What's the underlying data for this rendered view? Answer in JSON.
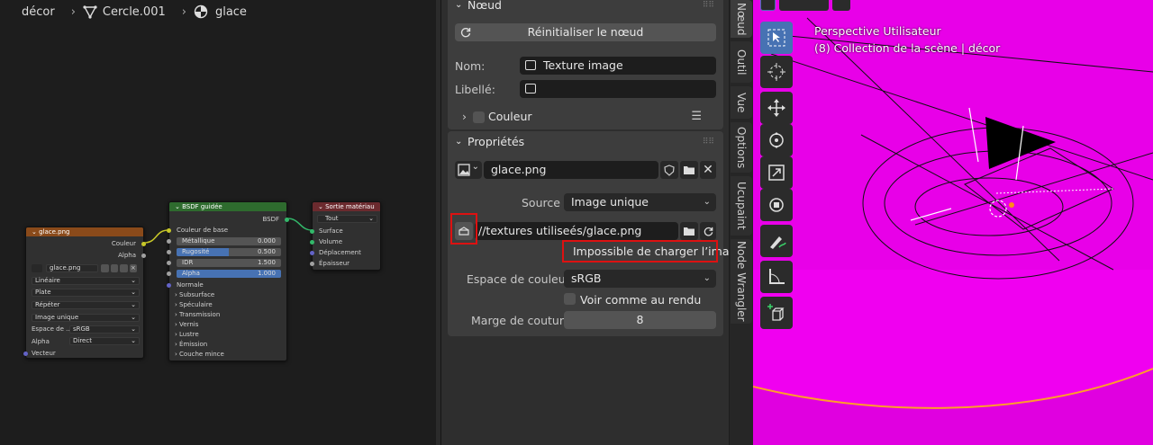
{
  "breadcrumb": {
    "items": [
      "décor",
      "Cercle.001",
      "glace"
    ]
  },
  "node_editor": {
    "image_node": {
      "title": "glace.png",
      "outputs": [
        "Couleur",
        "Alpha"
      ],
      "image_name": "glace.png",
      "interpolation": "Linéaire",
      "projection": "Plate",
      "extension": "Répéter",
      "source": "Image unique",
      "colorspace_label": "Espace de ...",
      "colorspace_value": "sRGB",
      "alpha_label": "Alpha",
      "alpha_value": "Direct",
      "input": "Vecteur"
    },
    "bsdf_node": {
      "title": "BSDF guidée",
      "output": "BSDF",
      "base_color": "Couleur de base",
      "sliders": [
        {
          "label": "Métallique",
          "value": "0.000",
          "fill": 0
        },
        {
          "label": "Rugosité",
          "value": "0.500",
          "fill": 0.5
        },
        {
          "label": "IDR",
          "value": "1.500",
          "fill": 0
        },
        {
          "label": "Alpha",
          "value": "1.000",
          "fill": 1
        }
      ],
      "normal": "Normale",
      "sections": [
        "Subsurface",
        "Spéculaire",
        "Transmission",
        "Vernis",
        "Lustre",
        "Émission",
        "Couche mince"
      ]
    },
    "output_node": {
      "title": "Sortie matériau",
      "target": "Tout",
      "inputs": [
        "Surface",
        "Volume",
        "Déplacement",
        "Épaisseur"
      ]
    }
  },
  "properties": {
    "node_panel": {
      "title": "Nœud",
      "reset_button": "Réinitialiser le nœud",
      "name_label": "Nom:",
      "name_value": "Texture image",
      "label_label": "Libellé:",
      "label_value": "",
      "color_label": "Couleur"
    },
    "props_panel": {
      "title": "Propriétés",
      "image_name": "glace.png",
      "source_label": "Source",
      "source_value": "Image unique",
      "filepath": "//textures utiliseés/glace.png",
      "error": "Impossible de charger l’image",
      "colorspace_label": "Espace de couleur",
      "colorspace_value": "sRGB",
      "view_as_render": "Voir comme au rendu",
      "margin_label": "Marge de couture",
      "margin_value": "8"
    }
  },
  "side_tabs": [
    "Nœud",
    "Outil",
    "Vue",
    "Options",
    "Ucupaint",
    "Node Wrangler"
  ],
  "viewport": {
    "view_name": "Perspective Utilisateur",
    "collection": "(8) Collection de la scène | décor",
    "background_color": "#e800e8",
    "tools": [
      "select-box-icon",
      "cursor-icon",
      "move-icon",
      "rotate-icon",
      "scale-icon",
      "transform-icon",
      "annotate-icon",
      "measure-icon",
      "add-cube-icon"
    ]
  },
  "colors": {
    "image_node_header": "#8a4a1a",
    "bsdf_header": "#2e6b2e",
    "output_header": "#6b2a2e",
    "slider_fill": "#4772b3",
    "highlight_box": "#d11111"
  }
}
